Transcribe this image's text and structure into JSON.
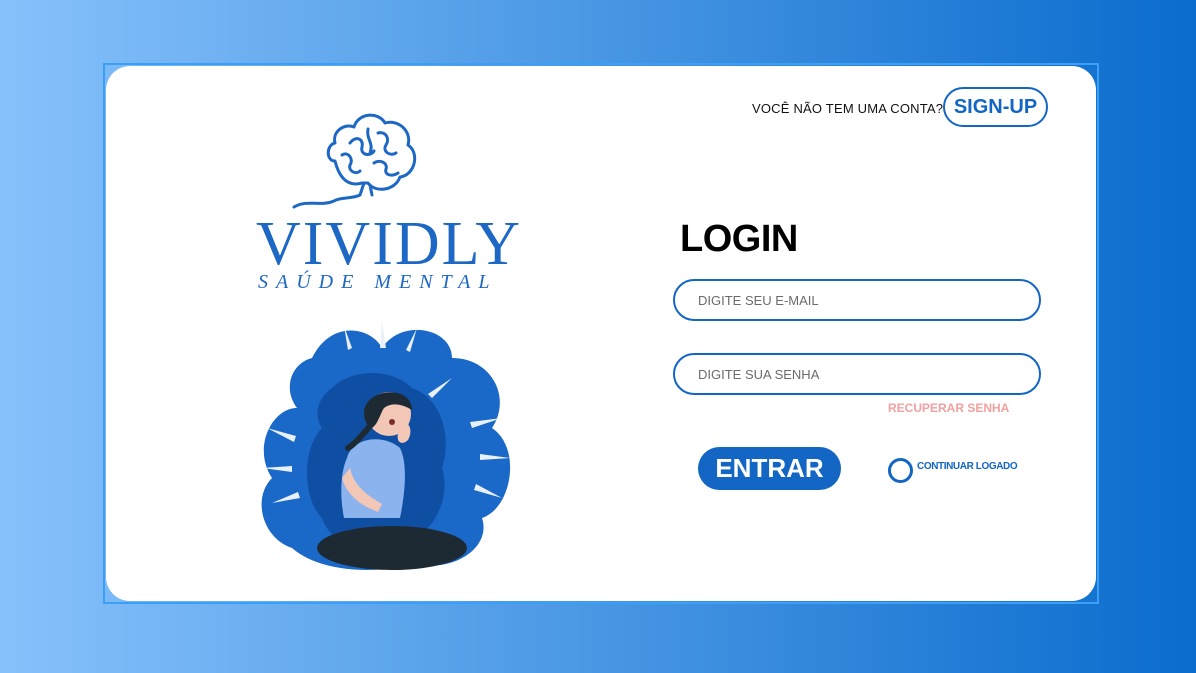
{
  "header": {
    "signup_prompt": "VOCÊ NÃO TEM UMA CONTA?",
    "signup_label": "SIGN-UP"
  },
  "brand": {
    "name": "VIVIDLY",
    "tagline": "SAÚDE MENTAL"
  },
  "login": {
    "title": "LOGIN",
    "email_placeholder": "DIGITE SEU E-MAIL",
    "email_value": "",
    "password_placeholder": "DIGITE SUA SENHA",
    "password_value": "",
    "recover_label": "RECUPERAR SENHA",
    "submit_label": "ENTRAR",
    "remember_label": "CONTINUAR LOGADO",
    "remember_checked": false
  },
  "colors": {
    "accent": "#1366c3",
    "recover_link": "#f3a0a0",
    "background_start": "#86c1fb",
    "background_end": "#0b6ccd"
  },
  "icons": {
    "logo": "brain-icon",
    "illustration": "anxious-woman-with-hands-illustration"
  }
}
